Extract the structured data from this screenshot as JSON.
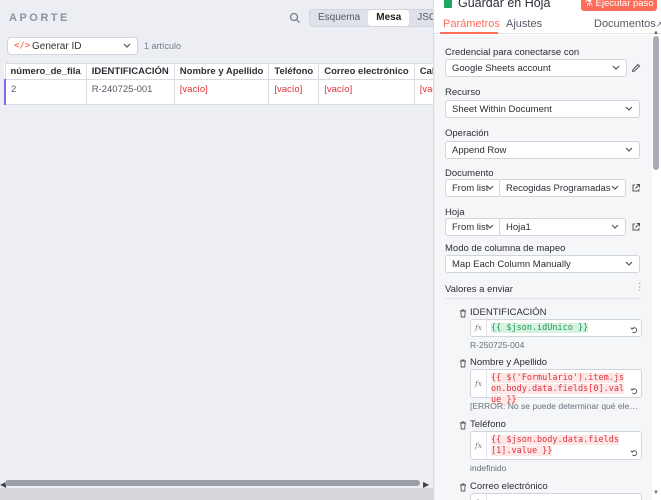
{
  "left": {
    "title": "APORTE",
    "view_tabs": [
      "Esquema",
      "Mesa",
      "JSON"
    ],
    "active_tab": "Mesa",
    "node_selector": {
      "icon": "code-icon",
      "label": "Generar ID"
    },
    "item_count": "1 artículo",
    "table": {
      "headers": [
        "número_de_fila",
        "IDENTIFICACIÓN",
        "Nombre y Apellido",
        "Teléfono",
        "Correo electrónico",
        "Calle"
      ],
      "rows": [
        [
          "2",
          "R-240725-001",
          "[vacío]",
          "[vacío]",
          "[vacío]",
          "[vacío]"
        ]
      ]
    }
  },
  "right": {
    "node": {
      "title": "Guardar en Hoja",
      "icon": "sheets-icon",
      "execute_label": "Ejecutar paso"
    },
    "tabs": {
      "params": "Parámetros",
      "settings": "Ajustes",
      "docs": "Documentos"
    },
    "credential": {
      "label": "Credencial para conectarse con",
      "value": "Google Sheets account"
    },
    "resource": {
      "label": "Recurso",
      "value": "Sheet Within Document"
    },
    "operation": {
      "label": "Operación",
      "value": "Append Row"
    },
    "document": {
      "label": "Documento",
      "mode": "From list",
      "value": "Recogidas Programadas"
    },
    "sheet": {
      "label": "Hoja",
      "mode": "From list",
      "value": "Hoja1"
    },
    "mapping": {
      "label": "Modo de columna de mapeo",
      "value": "Map Each Column Manually"
    },
    "values_header": "Valores a enviar",
    "fields": [
      {
        "name": "IDENTIFICACIÓN",
        "expr": "{{ $json.idUnico }}",
        "result": "R-250725-004",
        "status": "ok"
      },
      {
        "name": "Nombre y Apellido",
        "expr": "{{ $('Formulario').item.json.body.data.fields[0].value }}",
        "result": "[ERROR: No se puede determinar qué elemento us...",
        "status": "error"
      },
      {
        "name": "Teléfono",
        "expr": "{{ $json.body.data.fields[1].value }}",
        "result": "indefinido",
        "status": "error"
      },
      {
        "name": "Correo electrónico",
        "expr": "",
        "result": "",
        "status": "ok"
      }
    ]
  },
  "colors": {
    "accent": "#ff6d5a",
    "ok": "#1a9b55",
    "error": "#e0313b",
    "sheets": "#1fa463"
  }
}
